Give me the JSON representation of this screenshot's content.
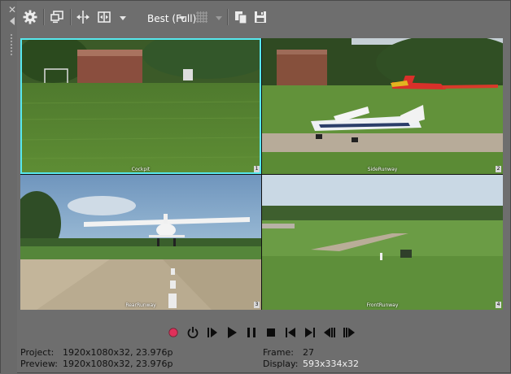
{
  "toolbar": {
    "quality_label": "Best (Full)",
    "icons": [
      "close-icon",
      "pin-icon",
      "settings-gear-icon",
      "external-monitor-icon",
      "split-screen-icon",
      "toggle-preview-icon",
      "quality-dropdown",
      "grid-overlay-icon",
      "copy-snapshot-icon",
      "save-snapshot-icon"
    ]
  },
  "video": {
    "cameras": [
      {
        "label": "Cockpit",
        "num": "1"
      },
      {
        "label": "SideRunway",
        "num": "2"
      },
      {
        "label": "RearRunway",
        "num": "3"
      },
      {
        "label": "FrontRunway",
        "num": "4"
      }
    ],
    "selected_index": 0,
    "selection_color": "#57e8ee"
  },
  "transport": {
    "buttons": [
      "record",
      "loop-playback",
      "play-from-start",
      "play",
      "pause",
      "stop",
      "previous-frame-start",
      "next-frame-end",
      "previous-frame",
      "next-frame"
    ],
    "record_color": "#e0305a"
  },
  "status": {
    "project_label": "Project:",
    "project_value": "1920x1080x32, 23.976p",
    "preview_label": "Preview:",
    "preview_value": "1920x1080x32, 23.976p",
    "frame_label": "Frame:",
    "frame_value": "27",
    "display_label": "Display:",
    "display_value": "593x334x32"
  }
}
